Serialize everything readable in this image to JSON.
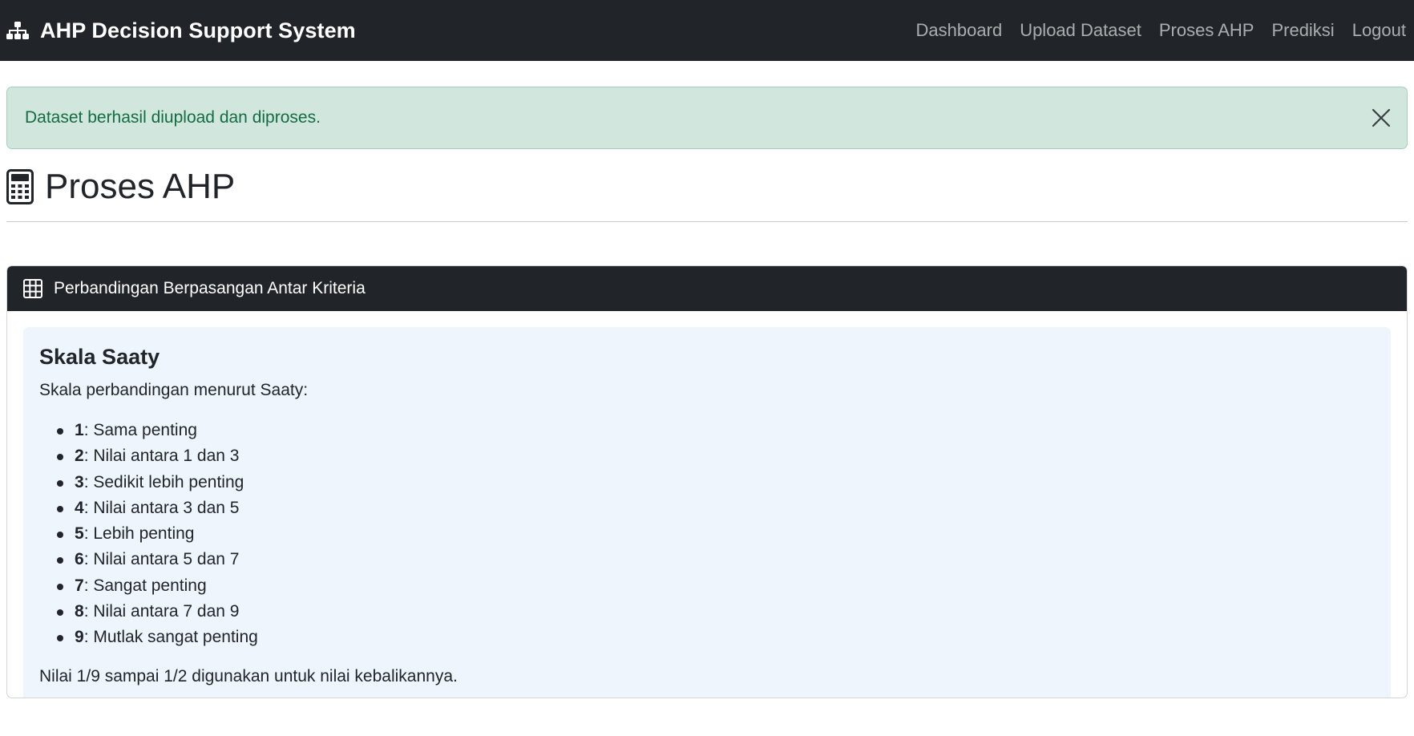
{
  "navbar": {
    "brand": "AHP Decision Support System",
    "brand_icon": "sitemap-icon",
    "links": [
      "Dashboard",
      "Upload Dataset",
      "Proses AHP",
      "Prediksi",
      "Logout"
    ]
  },
  "alert": {
    "message": "Dataset berhasil diupload dan diproses.",
    "type": "success"
  },
  "page": {
    "title": "Proses AHP",
    "title_icon": "calculator-icon"
  },
  "card": {
    "header": "Perbandingan Berpasangan Antar Kriteria",
    "header_icon": "table-icon"
  },
  "saaty": {
    "title": "Skala Saaty",
    "description": "Skala perbandingan menurut Saaty:",
    "items": [
      {
        "num": "1",
        "text": ": Sama penting"
      },
      {
        "num": "2",
        "text": ": Nilai antara 1 dan 3"
      },
      {
        "num": "3",
        "text": ": Sedikit lebih penting"
      },
      {
        "num": "4",
        "text": ": Nilai antara 3 dan 5"
      },
      {
        "num": "5",
        "text": ": Lebih penting"
      },
      {
        "num": "6",
        "text": ": Nilai antara 5 dan 7"
      },
      {
        "num": "7",
        "text": ": Sangat penting"
      },
      {
        "num": "8",
        "text": ": Nilai antara 7 dan 9"
      },
      {
        "num": "9",
        "text": ": Mutlak sangat penting"
      }
    ],
    "note": "Nilai 1/9 sampai 1/2 digunakan untuk nilai kebalikannya."
  },
  "colors": {
    "navbar_bg": "#212529",
    "alert_bg": "#d1e7dd",
    "alert_text": "#146c43",
    "info_bg": "#eef5fd"
  }
}
